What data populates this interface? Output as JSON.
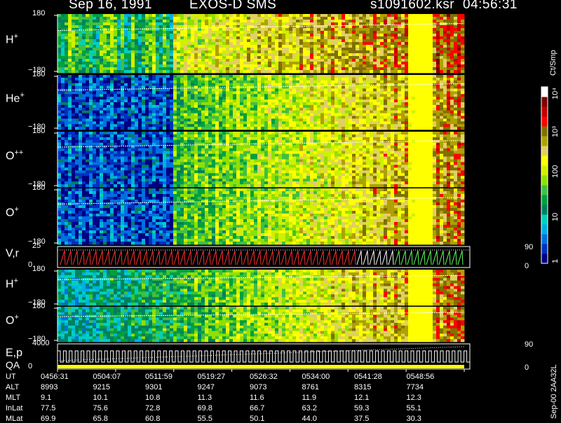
{
  "header": {
    "date": "Sep 16, 1991",
    "instrument": "EXOS-D SMS",
    "file": "s1091602.ksr",
    "time": "04:56:31"
  },
  "panels": [
    {
      "id": "h-plus-1",
      "label": "H",
      "charge": "+",
      "ymax": "180",
      "ymin": "−180"
    },
    {
      "id": "he-plus",
      "label": "He",
      "charge": "+",
      "ymax": "180",
      "ymin": "−180"
    },
    {
      "id": "o-plusplus",
      "label": "O",
      "charge": "++",
      "ymax": "180",
      "ymin": "−180"
    },
    {
      "id": "o-plus-1",
      "label": "O",
      "charge": "+",
      "ymax": "180",
      "ymin": "−180"
    },
    {
      "id": "vr",
      "label": "V,r",
      "charge": "",
      "ymax": "25",
      "ymin": "0",
      "rmax": "90",
      "rmin": "0"
    },
    {
      "id": "h-plus-2",
      "label": "H",
      "charge": "+",
      "ymax": "180",
      "ymin": "−180"
    },
    {
      "id": "o-plus-2",
      "label": "O",
      "charge": "+",
      "ymax": "180",
      "ymin": "−180"
    },
    {
      "id": "ep-qa",
      "label": "E,p",
      "label2": "QA",
      "charge": "",
      "ymax": "4000",
      "ymin": "0",
      "rmax": "90",
      "rmin": "0"
    }
  ],
  "colorbar": {
    "unit": "Ct/Smp",
    "ticks": [
      "1",
      "10",
      "100",
      "10³",
      "10⁴"
    ],
    "colors": [
      "#000080",
      "#0030c0",
      "#0070e0",
      "#00b0e0",
      "#00d0c0",
      "#008060",
      "#00a040",
      "#40c040",
      "#90e000",
      "#d0f000",
      "#ffff00",
      "#e0d060",
      "#b0a000",
      "#807000",
      "#ff0000",
      "#c00000",
      "#800000",
      "#ffffff"
    ]
  },
  "footer": {
    "rows": [
      {
        "label": "UT",
        "values": [
          "0456:31",
          "0504:07",
          "0511:59",
          "0519:27",
          "0526:32",
          "0534:00",
          "0541:28",
          "0548:56"
        ]
      },
      {
        "label": "ALT",
        "values": [
          "8993",
          "9215",
          "9301",
          "9247",
          "9073",
          "8761",
          "8315",
          "7734"
        ]
      },
      {
        "label": "MLT",
        "values": [
          "9.1",
          "10.1",
          "10.8",
          "11.3",
          "11.6",
          "11.9",
          "12.1",
          "12.3"
        ]
      },
      {
        "label": "InLat",
        "values": [
          "77.5",
          "75.6",
          "72.8",
          "69.8",
          "66.7",
          "63.2",
          "59.3",
          "55.1"
        ]
      },
      {
        "label": "MLat",
        "values": [
          "69.9",
          "65.8",
          "60.8",
          "55.5",
          "50.1",
          "44.0",
          "37.5",
          "30.3"
        ]
      }
    ],
    "stamp": "Sep-00  2AA32L"
  },
  "chart_data": {
    "type": "heatmap",
    "title": "Sep 16, 1991   EXOS-D SMS",
    "x": [
      "0456:31",
      "0504:07",
      "0511:59",
      "0519:27",
      "0526:32",
      "0534:00",
      "0541:28",
      "0548:56"
    ],
    "series": [
      {
        "name": "H+",
        "ylim": [
          -180,
          180
        ]
      },
      {
        "name": "He+",
        "ylim": [
          -180,
          180
        ]
      },
      {
        "name": "O++",
        "ylim": [
          -180,
          180
        ]
      },
      {
        "name": "O+",
        "ylim": [
          -180,
          180
        ]
      },
      {
        "name": "V,r",
        "ylim": [
          0,
          25
        ],
        "y2lim": [
          0,
          90
        ]
      },
      {
        "name": "H+",
        "ylim": [
          -180,
          180
        ]
      },
      {
        "name": "O+",
        "ylim": [
          -180,
          180
        ]
      },
      {
        "name": "E,p QA",
        "ylim": [
          0,
          4000
        ],
        "y2lim": [
          0,
          90
        ]
      }
    ],
    "colorscale": {
      "label": "Ct/Smp",
      "ticks": [
        1,
        10,
        100,
        1000,
        10000
      ],
      "scale": "log"
    }
  }
}
